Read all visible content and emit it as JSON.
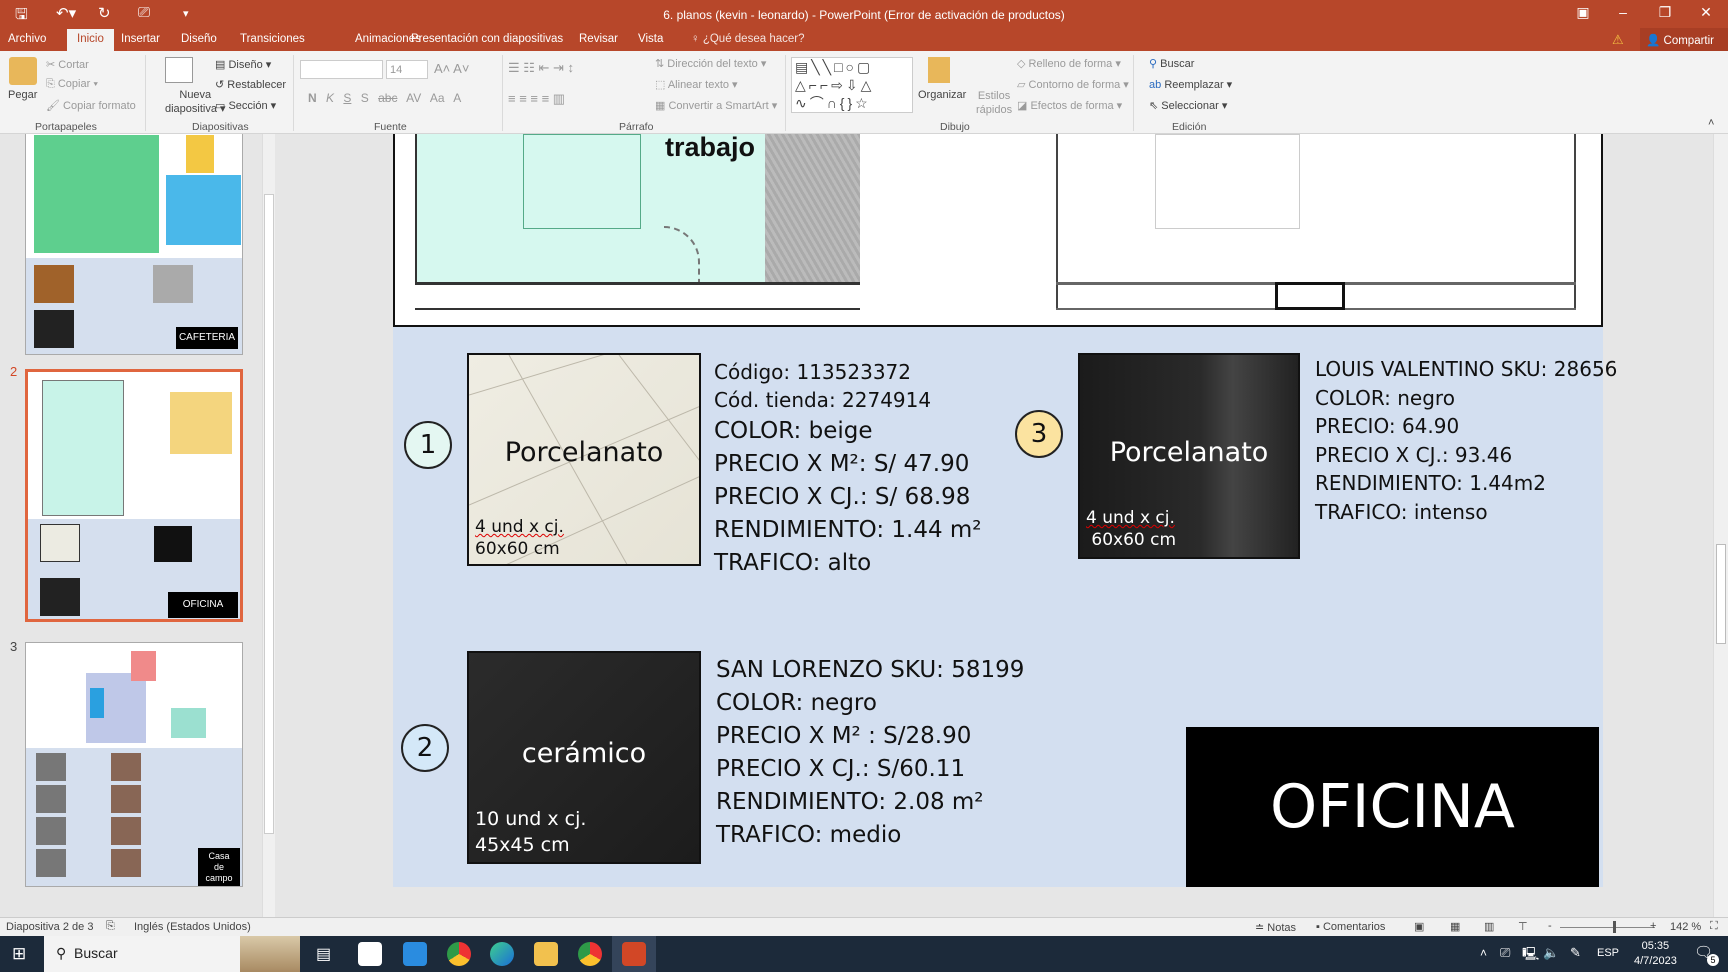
{
  "window": {
    "title": "6. planos (kevin - leonardo) - PowerPoint (Error de activación de productos)",
    "share": "Compartir"
  },
  "tabs": [
    "Archivo",
    "Inicio",
    "Insertar",
    "Diseño",
    "Transiciones",
    "Animaciones",
    "Presentación con diapositivas",
    "Revisar",
    "Vista"
  ],
  "tell_me": "¿Qué desea hacer?",
  "ribbon": {
    "portapapeles": {
      "paste": "Pegar",
      "cut": "Cortar",
      "copy": "Copiar",
      "format_painter": "Copiar formato",
      "label": "Portapapeles"
    },
    "diapositivas": {
      "new_slide_1": "Nueva",
      "new_slide_2": "diapositiva",
      "layout": "Diseño",
      "reset": "Restablecer",
      "section": "Sección",
      "label": "Diapositivas"
    },
    "fuente": {
      "font_size": "14",
      "label": "Fuente",
      "bold": "N",
      "italic": "K",
      "underline": "S",
      "shadow": "S",
      "strike": "abc",
      "spacing": "AV",
      "case": "Aa",
      "color": "A"
    },
    "parrafo": {
      "text_direction": "Dirección del texto",
      "align_text": "Alinear texto",
      "smartart": "Convertir a SmartArt",
      "label": "Párrafo"
    },
    "dibujo": {
      "arrange": "Organizar",
      "quick_styles_1": "Estilos",
      "quick_styles_2": "rápidos",
      "fill": "Relleno de forma",
      "outline": "Contorno de forma",
      "effects": "Efectos de forma",
      "label": "Dibujo"
    },
    "edicion": {
      "find": "Buscar",
      "replace": "Reemplazar",
      "select": "Seleccionar",
      "label": "Edición"
    }
  },
  "thumbnails": [
    {
      "number": "",
      "label": "CAFETERIA"
    },
    {
      "number": "2",
      "label": "OFICINA"
    },
    {
      "number": "3",
      "label_1": "Casa",
      "label_2": "de",
      "label_3": "campo"
    }
  ],
  "slide": {
    "plan_label": "trabajo",
    "items": [
      {
        "number": "1",
        "badge_color": "#e4f7f2",
        "tile_name": "Porcelanato",
        "tile_units": "4 und x cj.",
        "tile_size": "60x60 cm",
        "lines": [
          "Código: 113523372",
          "Cód. tienda: 2274914",
          "COLOR: beige",
          "PRECIO X M²: S/ 47.90",
          "PRECIO X CJ.: S/ 68.98",
          "RENDIMIENTO: 1.44 m²",
          "TRAFICO: alto"
        ]
      },
      {
        "number": "3",
        "badge_color": "#fbe3a0",
        "tile_name": "Porcelanato",
        "tile_units": "4 und x cj.",
        "tile_size": "60x60 cm",
        "lines": [
          "LOUIS VALENTINO SKU: 28656",
          "COLOR: negro",
          "PRECIO: 64.90",
          "PRECIO X CJ.: 93.46",
          "RENDIMIENTO: 1.44m2",
          "TRAFICO: intenso"
        ]
      },
      {
        "number": "2",
        "badge_color": "#d4e8f8",
        "tile_name": "cerámico",
        "tile_units": "10 und x cj.",
        "tile_size": "45x45 cm",
        "lines": [
          "SAN LORENZO SKU: 58199",
          "COLOR: negro",
          "PRECIO X M² : S/28.90",
          "PRECIO X CJ.: S/60.11",
          "RENDIMIENTO: 2.08 m²",
          "TRAFICO: medio"
        ]
      }
    ],
    "room_label": "OFICINA"
  },
  "status": {
    "slide_info": "Diapositiva 2 de 3",
    "language": "Inglés (Estados Unidos)",
    "notes": "Notas",
    "comments": "Comentarios",
    "zoom": "142 %",
    "zoom_level": 142
  },
  "taskbar": {
    "search": "Buscar",
    "lang": "ESP",
    "time": "05:35",
    "date": "4/7/2023",
    "notifications": "5"
  }
}
